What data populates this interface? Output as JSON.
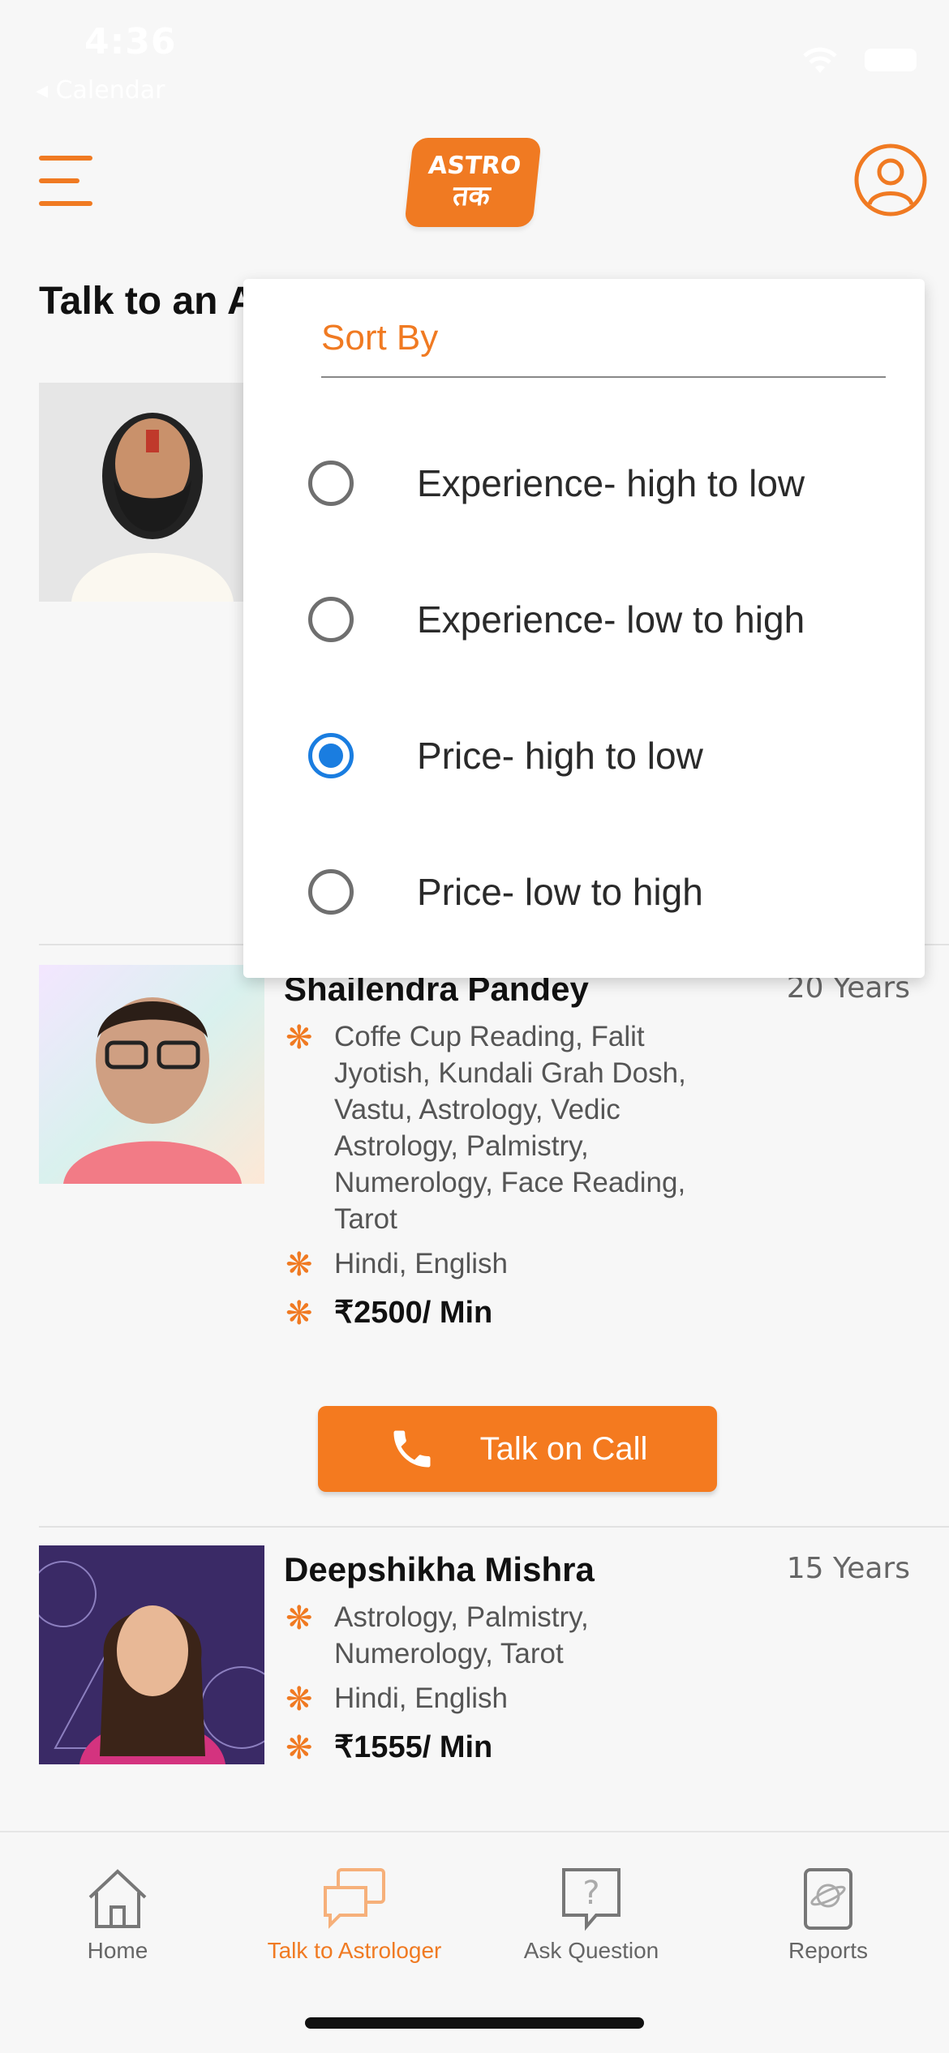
{
  "status_bar": {
    "time": "4:36",
    "back_label": "◂ Calendar"
  },
  "header": {
    "logo_top": "ASTRO",
    "logo_bottom": "तक"
  },
  "page": {
    "title": "Talk to an A"
  },
  "astrologers": [
    {
      "name": "Shailendra Pandey",
      "experience": "20 Years",
      "skills": "Coffe Cup Reading, Falit Jyotish, Kundali Grah Dosh, Vastu, Astrology, Vedic Astrology, Palmistry, Numerology, Face Reading, Tarot",
      "languages": "Hindi, English",
      "price": "₹2500/ Min",
      "call_label": "Talk on Call"
    },
    {
      "name": "Deepshikha Mishra",
      "experience": "15 Years",
      "skills": "Astrology, Palmistry, Numerology, Tarot",
      "languages": "Hindi, English",
      "price": "₹1555/ Min"
    }
  ],
  "sort_popup": {
    "title": "Sort By",
    "options": [
      {
        "label": "Experience- high to low",
        "selected": false
      },
      {
        "label": "Experience- low to high",
        "selected": false
      },
      {
        "label": "Price- high to low",
        "selected": true
      },
      {
        "label": "Price- low to high",
        "selected": false
      }
    ]
  },
  "bottom_nav": {
    "items": [
      {
        "label": "Home",
        "icon": "home-icon",
        "active": false
      },
      {
        "label": "Talk to Astrologer",
        "icon": "chat-icon",
        "active": true
      },
      {
        "label": "Ask Question",
        "icon": "question-icon",
        "active": false
      },
      {
        "label": "Reports",
        "icon": "book-icon",
        "active": false
      }
    ]
  },
  "colors": {
    "accent": "#f07a22",
    "radio_selected": "#1a7de0"
  }
}
